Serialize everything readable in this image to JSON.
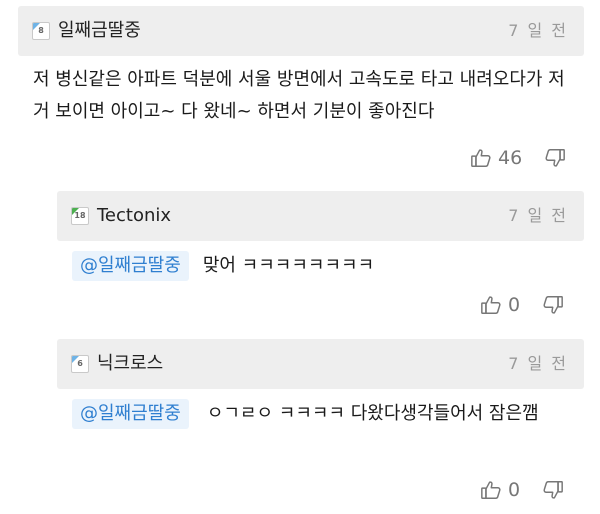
{
  "comments": [
    {
      "author": "일째금딸중",
      "level_badge": "8",
      "time": "7 일 전",
      "text": "저 병신같은 아파트 덕분에 서울 방면에서 고속도로 타고 내려오다가 저거 보이면 아이고~ 다 왔네~ 하면서 기분이 좋아진다",
      "likes": "46"
    },
    {
      "author": "Tectonix",
      "level_badge": "18",
      "time": "7 일 전",
      "mention": "@일째금딸중",
      "text": "맞어 ㅋㅋㅋㅋㅋㅋㅋㅋ",
      "likes": "0"
    },
    {
      "author": "닉크로스",
      "level_badge": "6",
      "time": "7 일 전",
      "mention": "@일째금딸중",
      "text": "ㅇㄱㄹㅇ ㅋㅋㅋㅋ 다왔다생각들어서 잠은깸",
      "likes": "0"
    }
  ],
  "icons": {
    "like": "thumbs-up-icon",
    "dislike": "thumbs-down-icon"
  },
  "colors": {
    "header_bg": "#eeeeee",
    "mention_bg": "#eaf3fc",
    "mention_text": "#2f7fd0",
    "muted_text": "#9a9a9a"
  }
}
